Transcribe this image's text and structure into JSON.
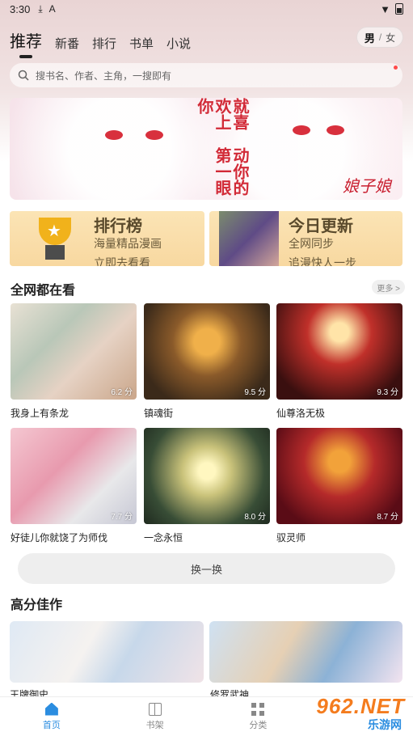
{
  "status_bar": {
    "time": "3:30",
    "download_icon": "download-icon",
    "a_icon": "A"
  },
  "nav": {
    "tabs": [
      {
        "label": "推荐",
        "active": true
      },
      {
        "label": "新番"
      },
      {
        "label": "排行"
      },
      {
        "label": "书单"
      },
      {
        "label": "小说"
      }
    ],
    "gender": {
      "male": "男",
      "sep": "/",
      "female": "女"
    }
  },
  "search": {
    "placeholder": "搜书名、作者、主角，一搜即有"
  },
  "banner": {
    "text_line1": "就喜欢上你",
    "text_line2": "动你的第一眼"
  },
  "promos": {
    "rank": {
      "title": "排行榜",
      "line1": "海量精品漫画",
      "line2": "立即去看看"
    },
    "update": {
      "title": "今日更新",
      "line1": "全网同步",
      "line2": "追漫快人一步"
    }
  },
  "section_hot": {
    "title": "全网都在看",
    "more": "更多 >",
    "items": [
      {
        "title": "我身上有条龙",
        "score": "6.2 分"
      },
      {
        "title": "镇魂街",
        "score": "9.5 分"
      },
      {
        "title": "仙尊洛无极",
        "score": "9.3 分"
      },
      {
        "title": "好徒儿你就饶了为师伐",
        "score": "7.7 分"
      },
      {
        "title": "一念永恒",
        "score": "8.0 分"
      },
      {
        "title": "驭灵师",
        "score": "8.7 分"
      }
    ],
    "swap_label": "换一换"
  },
  "section_top": {
    "title": "高分佳作",
    "items": [
      {
        "title": "王牌御史"
      },
      {
        "title": "修罗武神"
      }
    ]
  },
  "bottom_nav": [
    {
      "label": "首页",
      "icon": "home-icon",
      "active": true
    },
    {
      "label": "书架",
      "icon": "bookshelf-icon"
    },
    {
      "label": "分类",
      "icon": "category-grid-icon"
    }
  ],
  "watermark": {
    "num": "962.NET",
    "sub": "乐游网"
  },
  "colors": {
    "accent": "#2b8de0",
    "promo_bg": "#fbe4b5",
    "banner_red": "#d22a37"
  }
}
